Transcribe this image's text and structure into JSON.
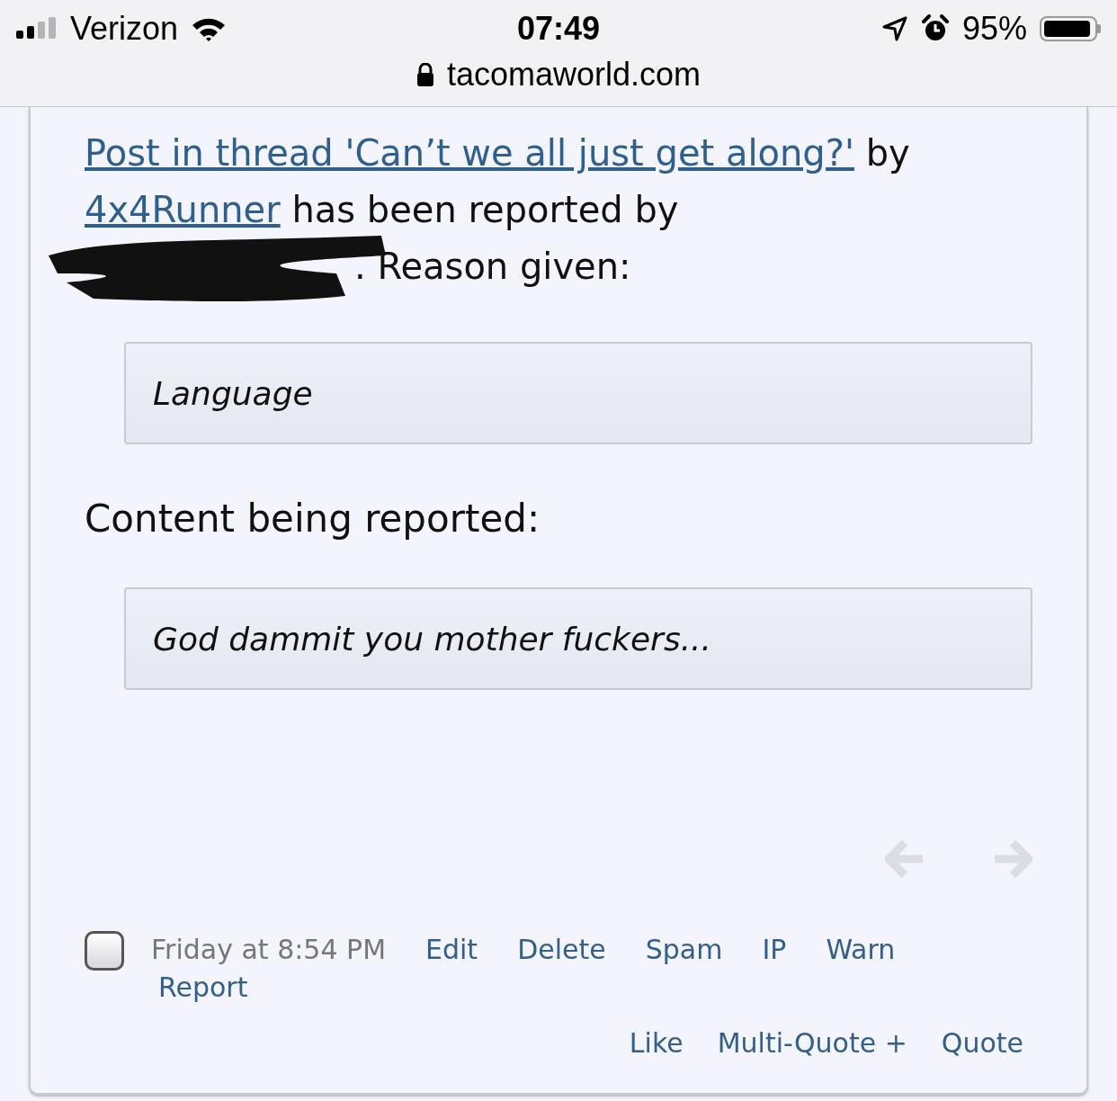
{
  "status_bar": {
    "carrier": "Verizon",
    "time": "07:49",
    "battery": "95%",
    "url": "tacomaworld.com"
  },
  "report": {
    "thread_link": "Post in thread 'Can’t we all just get along?'",
    "by": "by",
    "author_link": "4x4Runner",
    "reported_text": "has been reported by",
    "reason_label": ". Reason given:",
    "reason": "Language",
    "content_label": "Content being reported:",
    "content": "God dammit you mother fuckers..."
  },
  "nav_arrows": [
    {
      "kind": "prev",
      "disabled": true
    },
    {
      "kind": "next",
      "disabled": true
    }
  ],
  "post_meta": {
    "checked": false,
    "date": "Friday at 8:54 PM",
    "actions": [
      "Edit",
      "Delete",
      "Spam",
      "IP",
      "Warn",
      "Report"
    ],
    "bottom_actions": [
      "Like",
      "Multi-Quote +",
      "Quote"
    ]
  }
}
